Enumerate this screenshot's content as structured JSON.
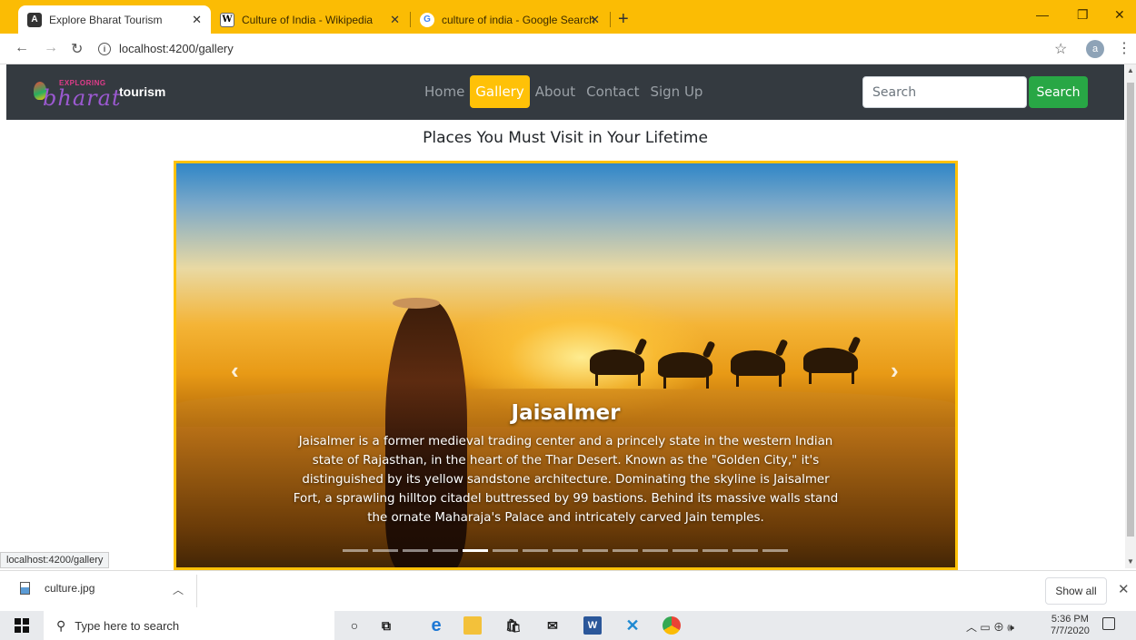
{
  "browser": {
    "tabs": [
      {
        "title": "Explore Bharat Tourism",
        "icon": "angular-icon"
      },
      {
        "title": "Culture of India - Wikipedia",
        "icon": "wikipedia-icon"
      },
      {
        "title": "culture of india - Google Search",
        "icon": "google-icon"
      }
    ],
    "active_tab": 0,
    "url": "localhost:4200/gallery",
    "profile_initial": "a",
    "accent_color": "#fbbc04"
  },
  "site": {
    "brand_small": "EXPLORING",
    "brand_logo": "bharat",
    "brand": "tourism",
    "nav": [
      "Home",
      "Gallery",
      "About",
      "Contact",
      "Sign Up"
    ],
    "active_nav": "Gallery",
    "search_placeholder": "Search",
    "search_button": "Search",
    "colors": {
      "navbar": "#343a40",
      "active": "#ffc107",
      "search_button": "#28a745"
    }
  },
  "page": {
    "heading": "Places You Must Visit in Your Lifetime",
    "carousel": {
      "title": "Jaisalmer",
      "description": "Jaisalmer is a former medieval trading center and a princely state in the western Indian state of Rajasthan, in the heart of the Thar Desert. Known as the \"Golden City,\" it's distinguished by its yellow sandstone architecture. Dominating the skyline is Jaisalmer Fort, a sprawling hilltop citadel buttressed by 99 bastions. Behind its massive walls stand the ornate Maharaja's Palace and intricately carved Jain temples.",
      "prev_icon": "chevron-left-icon",
      "next_icon": "chevron-right-icon",
      "slide_count": 15,
      "active_slide": 5
    }
  },
  "status_bar_url": "localhost:4200/gallery",
  "downloads": {
    "file": "culture.jpg",
    "show_all": "Show all"
  },
  "taskbar": {
    "search_placeholder": "Type here to search",
    "time": "5:36 PM",
    "date": "7/7/2020"
  }
}
